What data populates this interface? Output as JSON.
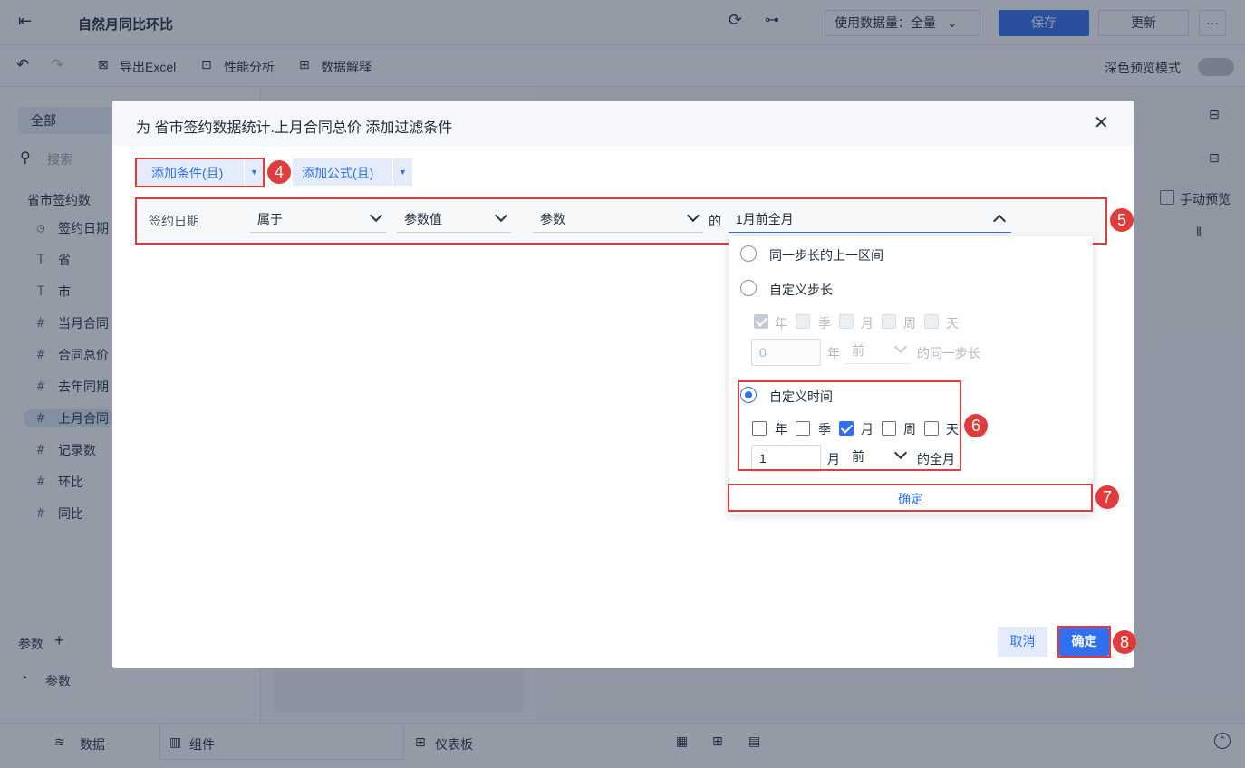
{
  "topbar": {
    "title": "自然月同比环比",
    "data_amount_label": "使用数据量：全量",
    "save_label": "保存",
    "update_label": "更新",
    "more_label": "···"
  },
  "toolbar": {
    "export_label": "导出Excel",
    "perf_label": "性能分析",
    "explain_label": "数据解释",
    "dark_preview_label": "深色预览模式"
  },
  "leftpanel": {
    "tab_all": "全部",
    "search_placeholder": "搜索",
    "dataset_name": "省市签约数",
    "fields": [
      {
        "icon": "clock",
        "label": "签约日期"
      },
      {
        "icon": "T",
        "label": "省"
      },
      {
        "icon": "T",
        "label": "市"
      },
      {
        "icon": "#",
        "label": "当月合同"
      },
      {
        "icon": "#",
        "label": "合同总价"
      },
      {
        "icon": "#",
        "label": "去年同期"
      },
      {
        "icon": "#",
        "label": "上月合同"
      },
      {
        "icon": "#",
        "label": "记录数"
      },
      {
        "icon": "#",
        "label": "环比"
      },
      {
        "icon": "#",
        "label": "同比"
      }
    ],
    "params_label": "参数",
    "param_item": "参数"
  },
  "rightpanel": {
    "manual_preview": "手动预览"
  },
  "bottombar": {
    "data_tab": "数据",
    "component_tab": "组件",
    "dashboard_tab": "仪表板"
  },
  "dialog": {
    "title": "为 省市签约数据统计.上月合同总价 添加过滤条件",
    "add_condition": "添加条件(且)",
    "add_formula": "添加公式(且)",
    "condition": {
      "field": "签约日期",
      "op": "属于",
      "value_type": "参数值",
      "param": "参数",
      "of_label": "的",
      "range_value": "1月前全月"
    },
    "popup": {
      "option1": "同一步长的上一区间",
      "option2": "自定义步长",
      "step_units": [
        "年",
        "季",
        "月",
        "周",
        "天"
      ],
      "step_value": "0",
      "step_unit_label": "年",
      "step_direction": "前",
      "step_suffix": "的同一步长",
      "option3": "自定义时间",
      "time_units": [
        "年",
        "季",
        "月",
        "周",
        "天"
      ],
      "time_value": "1",
      "time_unit_label": "月",
      "time_direction": "前",
      "time_suffix": "的全月",
      "confirm": "确定"
    },
    "cancel_label": "取消",
    "ok_label": "确定",
    "badges": [
      "4",
      "5",
      "6",
      "7",
      "8"
    ]
  }
}
